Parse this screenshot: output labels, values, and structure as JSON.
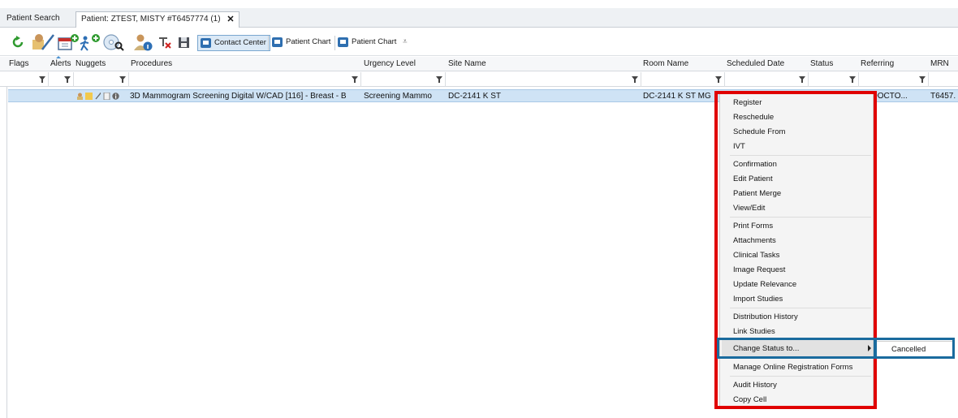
{
  "tabs": {
    "search": "Patient Search",
    "patient": "Patient: ZTEST, MISTY #T6457774 (1)",
    "close": "✕"
  },
  "toolbar": {
    "contact_center": "Contact Center",
    "patient_chart_1": "Patient Chart",
    "patient_chart_2": "Patient Chart",
    "overflow": "⩡"
  },
  "columns": {
    "flags": "Flags",
    "alerts": "Alerts",
    "nuggets": "Nuggets",
    "procedures": "Procedures",
    "urgency": "Urgency Level",
    "site": "Site Name",
    "room": "Room Name",
    "scheduled": "Scheduled Date",
    "status": "Status",
    "referring": "Referring",
    "mrn": "MRN"
  },
  "row": {
    "procedure": "3D Mammogram Screening Digital W/CAD [116] - Breast - B",
    "urgency": "Screening Mammo",
    "site": "DC-2141 K ST",
    "room": "DC-2141 K ST MG",
    "referring": "T, DOCTO...",
    "mrn": "T6457."
  },
  "menu": {
    "register": "Register",
    "reschedule": "Reschedule",
    "schedule_from": "Schedule From",
    "ivt": "IVT",
    "confirmation": "Confirmation",
    "edit_patient": "Edit Patient",
    "patient_merge": "Patient Merge",
    "view_edit": "View/Edit",
    "print_forms": "Print Forms",
    "attachments": "Attachments",
    "clinical_tasks": "Clinical Tasks",
    "image_request": "Image Request",
    "update_relevance": "Update Relevance",
    "import_studies": "Import Studies",
    "distribution_history": "Distribution History",
    "link_studies": "Link Studies",
    "change_status": "Change Status to...",
    "manage_online": "Manage Online Registration Forms",
    "audit_history": "Audit History",
    "copy_cell": "Copy Cell"
  },
  "submenu": {
    "cancelled": "Cancelled"
  },
  "colors": {
    "selection_row": "#cfe3f5",
    "annotation_red": "#e00000",
    "annotation_blue": "#1a6b9e"
  }
}
